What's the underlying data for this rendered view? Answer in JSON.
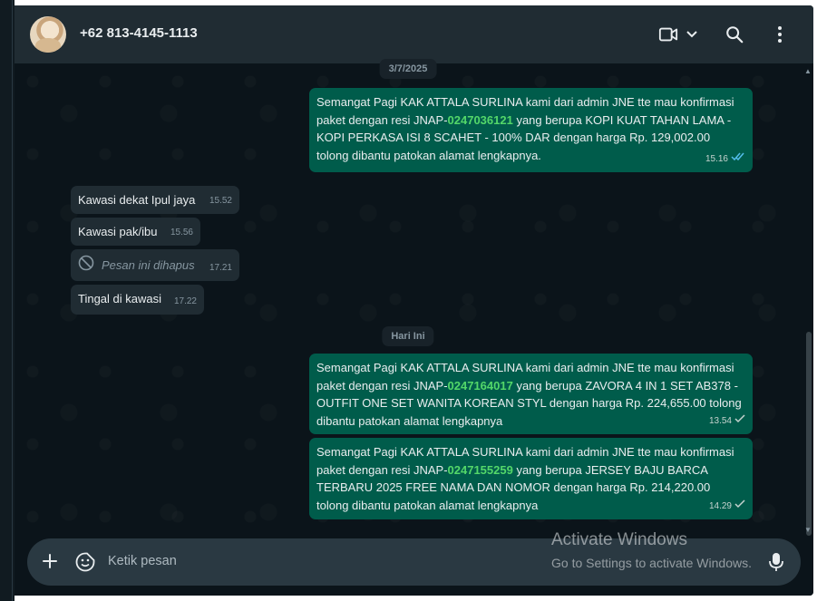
{
  "header": {
    "contact_name": "+62 813-4145-1113",
    "icons": [
      "video-call-icon",
      "chevron-down-icon",
      "search-icon",
      "menu-dots-icon"
    ]
  },
  "messages": {
    "date1": "3/7/2025",
    "m1": {
      "before": "Semangat Pagi KAK ATTALA SURLINA kami dari admin JNE tte mau konfirmasi paket dengan resi JNAP-",
      "resi": "0247036121",
      "after": " yang berupa KOPI KUAT TAHAN LAMA - KOPI PERKASA ISI 8 SCAHET - 100% DAR dengan harga Rp. 129,002.00 tolong dibantu patokan alamat lengkapnya.",
      "time": "15.16",
      "status": "read"
    },
    "m2": {
      "text": "Kawasi dekat Ipul jaya",
      "time": "15.52"
    },
    "m3": {
      "text": "Kawasi pak/ibu",
      "time": "15.56"
    },
    "m4": {
      "text": "Pesan ini dihapus",
      "time": "17.21"
    },
    "m5": {
      "text": "Tingal di kawasi",
      "time": "17.22"
    },
    "date2": "Hari Ini",
    "m6": {
      "before": "Semangat Pagi KAK ATTALA SURLINA kami dari admin JNE tte mau konfirmasi paket dengan resi JNAP-",
      "resi": "0247164017",
      "after": " yang berupa ZAVORA 4 IN 1 SET AB378 - OUTFIT ONE SET WANITA KOREAN STYL dengan harga Rp. 224,655.00 tolong dibantu patokan alamat lengkapnya",
      "time": "13.54",
      "status": "sent"
    },
    "m7": {
      "before": "Semangat Pagi KAK ATTALA SURLINA kami dari admin JNE tte mau konfirmasi paket dengan resi JNAP-",
      "resi": "0247155259",
      "after": " yang berupa JERSEY BAJU BARCA TERBARU 2025 FREE NAMA DAN NOMOR dengan harga Rp. 214,220.00 tolong dibantu patokan alamat lengkapnya",
      "time": "14.29",
      "status": "sent"
    }
  },
  "composer": {
    "placeholder": "Ketik pesan",
    "icons": [
      "plus-icon",
      "sticker-icon",
      "mic-icon"
    ]
  },
  "watermark": {
    "title": "Activate Windows",
    "subtitle": "Go to Settings to activate Windows."
  },
  "colors": {
    "app_bg": "#0b141a",
    "header_bg": "#202c33",
    "outgoing_bubble": "#005c4b",
    "incoming_bubble": "#202c33",
    "resi_link": "#53d769",
    "read_tick": "#53bdeb"
  }
}
